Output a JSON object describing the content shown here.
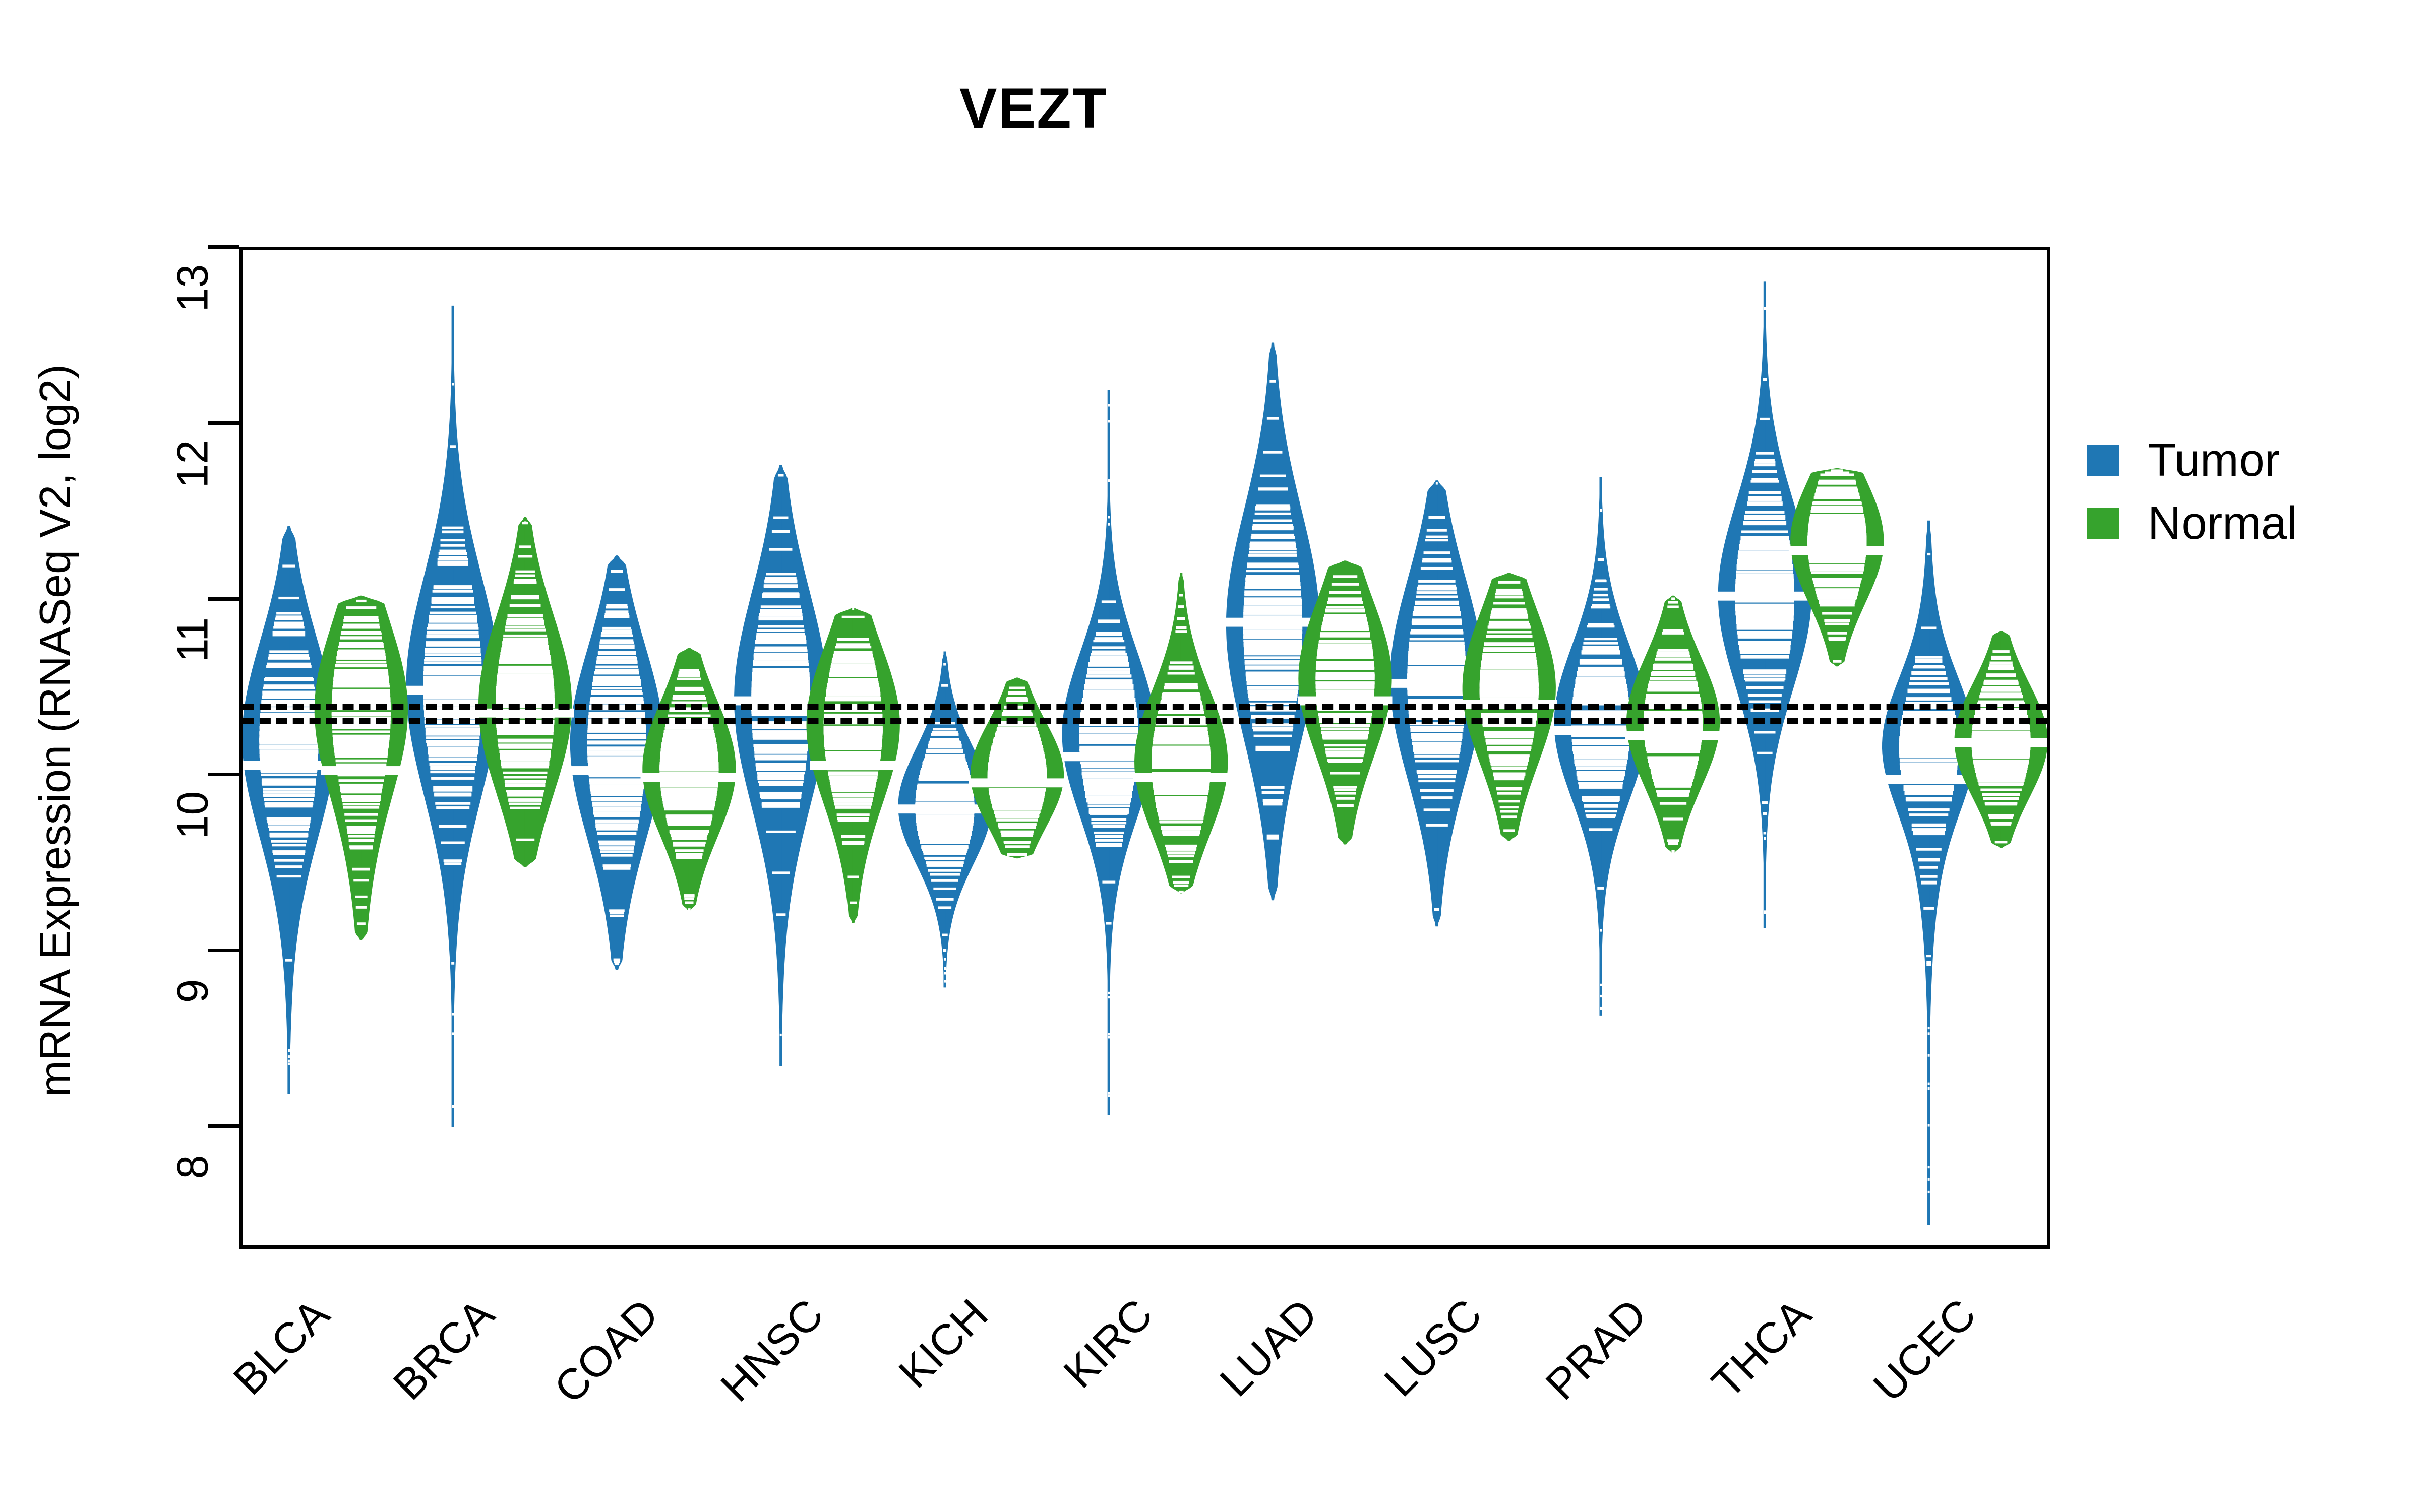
{
  "title": "VEZT",
  "axes": {
    "ylabel": "mRNA Expression (RNASeq V2, log2)",
    "yticks": [
      "8",
      "9",
      "10",
      "11",
      "12",
      "13"
    ],
    "xticks": [
      "BLCA",
      "BRCA",
      "COAD",
      "HNSC",
      "KICH",
      "KIRC",
      "LUAD",
      "LUSC",
      "PRAD",
      "THCA",
      "UCEC"
    ]
  },
  "legend": {
    "items": [
      {
        "label": "Tumor",
        "color": "#1f77b4"
      },
      {
        "label": "Normal",
        "color": "#36a32d"
      }
    ]
  },
  "colors": {
    "tumor": "#1f77b4",
    "normal": "#36a32d",
    "axis": "#000000",
    "background": "#ffffff"
  },
  "chart_data": {
    "type": "violin",
    "title": "VEZT",
    "xlabel": "",
    "ylabel": "mRNA Expression (RNASeq V2, log2)",
    "ylim": [
      7.3,
      13.0
    ],
    "yticks": [
      8,
      9,
      10,
      11,
      12,
      13
    ],
    "grid": false,
    "legend_position": "right",
    "categories": [
      "BLCA",
      "BRCA",
      "COAD",
      "HNSC",
      "KICH",
      "KIRC",
      "LUAD",
      "LUSC",
      "PRAD",
      "THCA",
      "UCEC"
    ],
    "reference_lines": [
      10.42,
      10.34
    ],
    "series": [
      {
        "name": "Tumor",
        "color": "#1f77b4",
        "stats": [
          {
            "category": "BLCA",
            "median": 10.05,
            "q1": 9.7,
            "q3": 10.42,
            "min": 8.17,
            "max": 11.42,
            "bulge_center": 10.25,
            "bulge_halfwidth": 0.52
          },
          {
            "category": "BRCA",
            "median": 10.48,
            "q1": 10.1,
            "q3": 10.85,
            "min": 7.98,
            "max": 12.68,
            "bulge_center": 10.52,
            "bulge_halfwidth": 0.6
          },
          {
            "category": "COAD",
            "median": 10.02,
            "q1": 9.72,
            "q3": 10.4,
            "min": 8.88,
            "max": 11.25,
            "bulge_center": 10.22,
            "bulge_halfwidth": 0.52
          },
          {
            "category": "HNSC",
            "median": 10.42,
            "q1": 10.0,
            "q3": 10.78,
            "min": 8.33,
            "max": 11.77,
            "bulge_center": 10.44,
            "bulge_halfwidth": 0.58
          },
          {
            "category": "KICH",
            "median": 9.8,
            "q1": 9.62,
            "q3": 10.0,
            "min": 8.78,
            "max": 10.7,
            "bulge_center": 9.82,
            "bulge_halfwidth": 0.32
          },
          {
            "category": "KIRC",
            "median": 10.1,
            "q1": 9.9,
            "q3": 10.45,
            "min": 8.05,
            "max": 12.2,
            "bulge_center": 10.25,
            "bulge_halfwidth": 0.45
          },
          {
            "category": "LUAD",
            "median": 10.87,
            "q1": 10.4,
            "q3": 11.2,
            "min": 9.28,
            "max": 12.47,
            "bulge_center": 10.88,
            "bulge_halfwidth": 0.62
          },
          {
            "category": "LUSC",
            "median": 10.52,
            "q1": 10.18,
            "q3": 10.88,
            "min": 9.13,
            "max": 11.68,
            "bulge_center": 10.55,
            "bulge_halfwidth": 0.55
          },
          {
            "category": "PRAD",
            "median": 10.25,
            "q1": 10.02,
            "q3": 10.55,
            "min": 8.62,
            "max": 11.7,
            "bulge_center": 10.3,
            "bulge_halfwidth": 0.42
          },
          {
            "category": "THCA",
            "median": 11.02,
            "q1": 10.72,
            "q3": 11.32,
            "min": 9.12,
            "max": 12.82,
            "bulge_center": 11.03,
            "bulge_halfwidth": 0.52
          },
          {
            "category": "UCEC",
            "median": 9.97,
            "q1": 9.72,
            "q3": 10.38,
            "min": 7.42,
            "max": 11.45,
            "bulge_center": 10.18,
            "bulge_halfwidth": 0.35
          }
        ]
      },
      {
        "name": "Normal",
        "color": "#36a32d",
        "stats": [
          {
            "category": "BLCA",
            "median": 10.02,
            "q1": 9.78,
            "q3": 10.5,
            "min": 9.05,
            "max": 11.02,
            "bulge_center": 10.42,
            "bulge_halfwidth": 0.46
          },
          {
            "category": "BRCA",
            "median": 10.35,
            "q1": 10.1,
            "q3": 10.62,
            "min": 9.47,
            "max": 11.47,
            "bulge_center": 10.42,
            "bulge_halfwidth": 0.52
          },
          {
            "category": "COAD",
            "median": 9.98,
            "q1": 9.78,
            "q3": 10.2,
            "min": 9.22,
            "max": 10.72,
            "bulge_center": 10.05,
            "bulge_halfwidth": 0.38
          },
          {
            "category": "HNSC",
            "median": 10.05,
            "q1": 9.88,
            "q3": 10.45,
            "min": 9.15,
            "max": 10.95,
            "bulge_center": 10.32,
            "bulge_halfwidth": 0.42
          },
          {
            "category": "KICH",
            "median": 9.95,
            "q1": 9.8,
            "q3": 10.18,
            "min": 9.52,
            "max": 10.55,
            "bulge_center": 10.0,
            "bulge_halfwidth": 0.28
          },
          {
            "category": "KIRC",
            "median": 9.98,
            "q1": 9.8,
            "q3": 10.28,
            "min": 9.32,
            "max": 11.15,
            "bulge_center": 10.08,
            "bulge_halfwidth": 0.4
          },
          {
            "category": "LUAD",
            "median": 10.42,
            "q1": 10.2,
            "q3": 10.72,
            "min": 9.6,
            "max": 11.22,
            "bulge_center": 10.58,
            "bulge_halfwidth": 0.42
          },
          {
            "category": "LUSC",
            "median": 10.4,
            "q1": 10.18,
            "q3": 10.68,
            "min": 9.62,
            "max": 11.15,
            "bulge_center": 10.52,
            "bulge_halfwidth": 0.42
          },
          {
            "category": "PRAD",
            "median": 10.22,
            "q1": 10.05,
            "q3": 10.45,
            "min": 9.55,
            "max": 11.02,
            "bulge_center": 10.32,
            "bulge_halfwidth": 0.36
          },
          {
            "category": "THCA",
            "median": 11.28,
            "q1": 11.12,
            "q3": 11.48,
            "min": 10.62,
            "max": 11.75,
            "bulge_center": 11.36,
            "bulge_halfwidth": 0.36
          },
          {
            "category": "UCEC",
            "median": 10.18,
            "q1": 10.0,
            "q3": 10.35,
            "min": 9.58,
            "max": 10.82,
            "bulge_center": 10.2,
            "bulge_halfwidth": 0.32
          }
        ]
      }
    ]
  }
}
